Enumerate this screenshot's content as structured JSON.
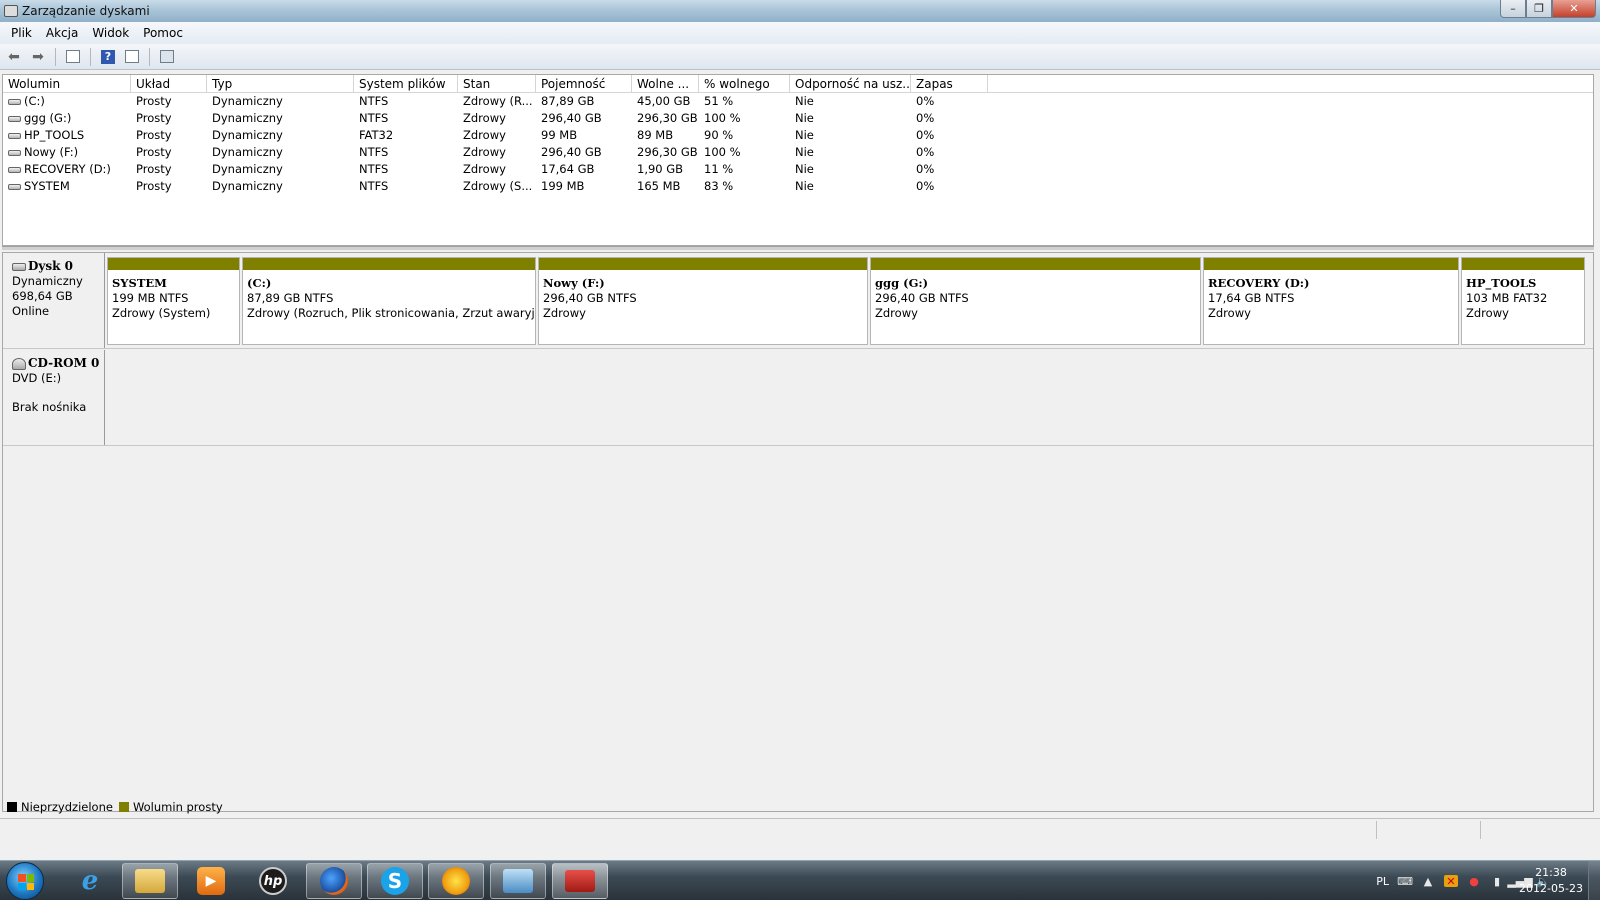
{
  "window": {
    "title": "Zarządzanie dyskami"
  },
  "menu": [
    "Plik",
    "Akcja",
    "Widok",
    "Pomoc"
  ],
  "columns": [
    "Wolumin",
    "Układ",
    "Typ",
    "System plików",
    "Stan",
    "Pojemność",
    "Wolne ...",
    "% wolnego",
    "Odporność na usz...",
    "Zapas"
  ],
  "volumes": [
    [
      "(C:)",
      "Prosty",
      "Dynamiczny",
      "NTFS",
      "Zdrowy (R...",
      "87,89 GB",
      "45,00 GB",
      "51 %",
      "Nie",
      "0%"
    ],
    [
      "ggg (G:)",
      "Prosty",
      "Dynamiczny",
      "NTFS",
      "Zdrowy",
      "296,40 GB",
      "296,30 GB",
      "100 %",
      "Nie",
      "0%"
    ],
    [
      "HP_TOOLS",
      "Prosty",
      "Dynamiczny",
      "FAT32",
      "Zdrowy",
      "99 MB",
      "89 MB",
      "90 %",
      "Nie",
      "0%"
    ],
    [
      "Nowy (F:)",
      "Prosty",
      "Dynamiczny",
      "NTFS",
      "Zdrowy",
      "296,40 GB",
      "296,30 GB",
      "100 %",
      "Nie",
      "0%"
    ],
    [
      "RECOVERY (D:)",
      "Prosty",
      "Dynamiczny",
      "NTFS",
      "Zdrowy",
      "17,64 GB",
      "1,90 GB",
      "11 %",
      "Nie",
      "0%"
    ],
    [
      "SYSTEM",
      "Prosty",
      "Dynamiczny",
      "NTFS",
      "Zdrowy (S...",
      "199 MB",
      "165 MB",
      "83 %",
      "Nie",
      "0%"
    ]
  ],
  "disk0": {
    "name": "Dysk 0",
    "type": "Dynamiczny",
    "size": "698,64 GB",
    "status": "Online",
    "partitions": [
      {
        "name": "SYSTEM",
        "size": "199 MB NTFS",
        "status": "Zdrowy (System)"
      },
      {
        "name": " (C:)",
        "size": "87,89 GB NTFS",
        "status": "Zdrowy (Rozruch, Plik stronicowania, Zrzut awaryjny)"
      },
      {
        "name": "Nowy  (F:)",
        "size": "296,40 GB NTFS",
        "status": "Zdrowy"
      },
      {
        "name": "ggg  (G:)",
        "size": "296,40 GB NTFS",
        "status": "Zdrowy"
      },
      {
        "name": "RECOVERY  (D:)",
        "size": "17,64 GB NTFS",
        "status": "Zdrowy"
      },
      {
        "name": "HP_TOOLS",
        "size": "103 MB FAT32",
        "status": "Zdrowy"
      }
    ]
  },
  "cdrom0": {
    "name": "CD-ROM 0",
    "drive": "DVD (E:)",
    "status": "Brak nośnika"
  },
  "legend": {
    "unallocated": "Nieprzydzielone",
    "simple": "Wolumin prosty",
    "unallocated_color": "#000000",
    "simple_color": "#808000"
  },
  "taskbar": {
    "apps": [
      "internet-explorer",
      "explorer",
      "media-player",
      "hp",
      "firefox",
      "skype",
      "weather",
      "remote-desktop",
      "disk-management"
    ],
    "language": "PL",
    "time": "21:38",
    "date": "2012-05-23"
  }
}
